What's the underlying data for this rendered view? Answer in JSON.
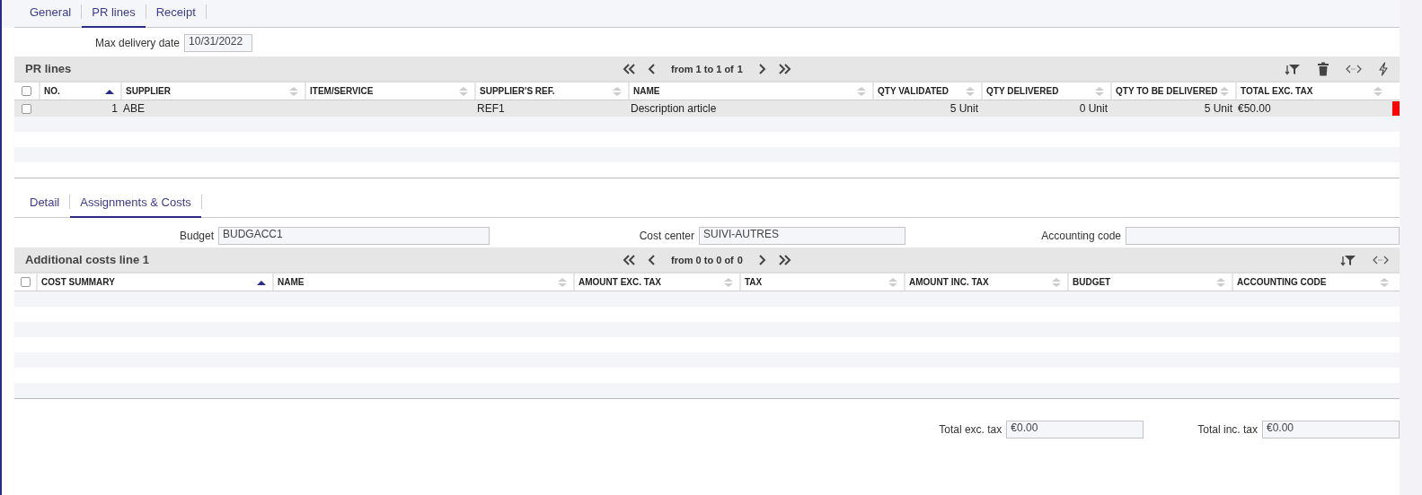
{
  "top_tabs": [
    {
      "label": "General",
      "selected": false
    },
    {
      "label": "PR lines",
      "selected": true
    },
    {
      "label": "Receipt",
      "selected": false
    }
  ],
  "max_delivery_date": {
    "label": "Max delivery date",
    "value": "10/31/2022"
  },
  "pr_lines": {
    "title": "PR lines",
    "pager": {
      "label": "from 1 to 1 of",
      "total": "1"
    },
    "all_checked": false,
    "columns": [
      {
        "label": "NO.",
        "sorted": true
      },
      {
        "label": "SUPPLIER",
        "sorted": false
      },
      {
        "label": "ITEM/SERVICE",
        "sorted": false
      },
      {
        "label": "SUPPLIER'S REF.",
        "sorted": false
      },
      {
        "label": "NAME",
        "sorted": false
      },
      {
        "label": "QTY VALIDATED",
        "sorted": false
      },
      {
        "label": "QTY DELIVERED",
        "sorted": false
      },
      {
        "label": "QTY TO BE DELIVERED",
        "sorted": false
      },
      {
        "label": "TOTAL EXC. TAX",
        "sorted": false
      }
    ],
    "rows": [
      {
        "checked": false,
        "color": "#ff0000",
        "cells": [
          "1",
          "ABE",
          "",
          "REF1",
          "Description article",
          "5 Unit",
          "0 Unit",
          "5 Unit",
          "€50.00"
        ]
      }
    ]
  },
  "detail_tabs": [
    {
      "label": "Detail",
      "selected": false
    },
    {
      "label": "Assignments & Costs",
      "selected": true
    }
  ],
  "assignment_fields": [
    {
      "label": "Budget",
      "value": "BUDGACC1"
    },
    {
      "label": "Cost center",
      "value": "SUIVI-AUTRES"
    },
    {
      "label": "Accounting code"
    }
  ],
  "additional_costs": {
    "title": "Additional costs line 1",
    "pager": {
      "label": "from 0 to 0 of",
      "total": "0"
    },
    "all_checked": false,
    "columns": [
      {
        "label": "COST SUMMARY",
        "sorted": true
      },
      {
        "label": "NAME",
        "sorted": false
      },
      {
        "label": "AMOUNT EXC. TAX",
        "sorted": false
      },
      {
        "label": "TAX",
        "sorted": false
      },
      {
        "label": "AMOUNT INC. TAX",
        "sorted": false
      },
      {
        "label": "BUDGET",
        "sorted": false
      },
      {
        "label": "ACCOUNTING CODE",
        "sorted": false
      }
    ]
  },
  "totals": [
    {
      "label": "Total exc. tax",
      "value": "€0.00"
    },
    {
      "label": "Total inc. tax",
      "value": "€0.00"
    }
  ]
}
